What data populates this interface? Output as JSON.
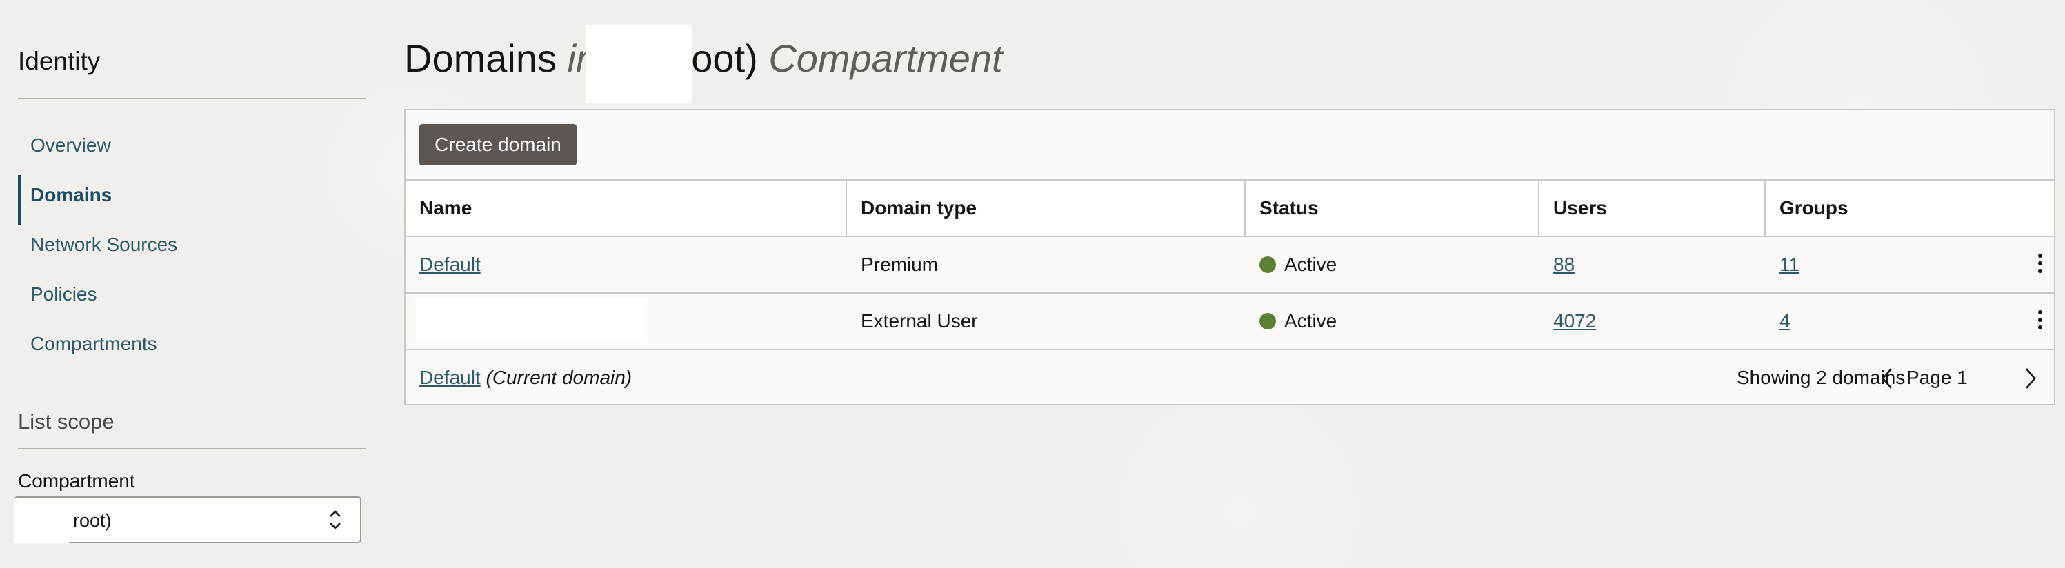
{
  "sidebar": {
    "title": "Identity",
    "items": [
      {
        "label": "Overview",
        "active": false
      },
      {
        "label": "Domains",
        "active": true
      },
      {
        "label": "Network Sources",
        "active": false
      },
      {
        "label": "Policies",
        "active": false
      },
      {
        "label": "Compartments",
        "active": false
      }
    ],
    "scope_title": "List scope",
    "compartment_label": "Compartment",
    "compartment_value": "root)"
  },
  "page": {
    "title_main": "Domains",
    "title_in": "ir",
    "title_root": "root)",
    "title_compartment": "Compartment"
  },
  "toolbar": {
    "create_label": "Create domain"
  },
  "table": {
    "headers": {
      "name": "Name",
      "domain_type": "Domain type",
      "status": "Status",
      "users": "Users",
      "groups": "Groups"
    },
    "rows": [
      {
        "name": "Default",
        "domain_type": "Premium",
        "status": "Active",
        "users": "88",
        "groups": "11"
      },
      {
        "name": "",
        "domain_type": "External User",
        "status": "Active",
        "users": "4072",
        "groups": "4"
      }
    ]
  },
  "footer": {
    "domain_link": "Default",
    "current_note": "(Current domain)",
    "showing": "Showing 2 domains",
    "page_label": "Page 1"
  },
  "colors": {
    "accent_link": "#2c5967",
    "status_active": "#5b8035",
    "button_bg": "#5c5753"
  }
}
